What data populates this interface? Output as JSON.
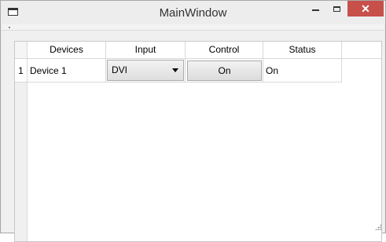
{
  "window": {
    "title": "MainWindow",
    "close_glyph": "✕"
  },
  "table": {
    "headers": [
      "Devices",
      "Input",
      "Control",
      "Status"
    ],
    "rows": [
      {
        "row_number": "1",
        "device": "Device 1",
        "input": "DVI",
        "control": "On",
        "status": "On"
      }
    ]
  },
  "icons": {
    "app": "window-icon",
    "minimize": "minimize-icon",
    "maximize": "maximize-icon",
    "close": "close-icon",
    "dropdown": "chevron-down-icon",
    "resize": "resize-grip-icon"
  },
  "colors": {
    "close_button": "#c7504b",
    "window_bg": "#f0f0f0"
  }
}
